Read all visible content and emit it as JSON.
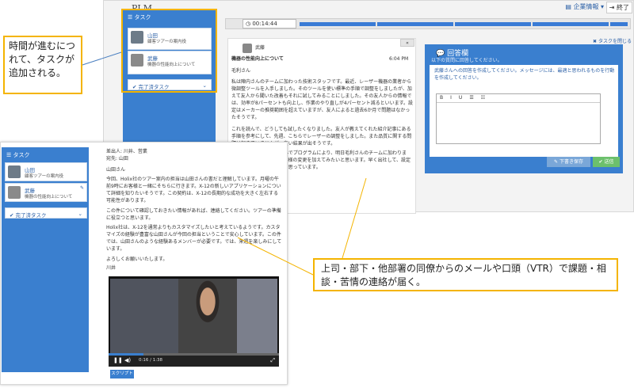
{
  "back": {
    "app_title": "PLM",
    "company_menu": "企業情報",
    "exit_label": "終了",
    "timer": "00:14:44",
    "close_task": "タスクを閉じる",
    "collapse": "«",
    "sidebar": {
      "header": "タスク",
      "tasks": [
        {
          "name": "山田",
          "subtitle": "顧客ツアーの案内役"
        },
        {
          "name": "武藤",
          "subtitle": "機器の性能向上について"
        }
      ],
      "done": "完了済タスク"
    },
    "mail": {
      "sender": "武藤",
      "subject": "機器の性能向上について",
      "time": "6:04 PM",
      "greeting": "毛利さん",
      "para1": "私は陣内さんのチームに加わった技術スタッフです。最近、レーザー機器の業者から微調整ツールを入手しました。そのツールを使い標準の手順で調整をしましたが、加えて友人から聞いた改善もそれに試してみることにしました。その友人からの情報では、効率が8パーセントも向上し、作業のやり直しが4パーセント減るといいます。設定はメーカーの推奨範囲を超えていますが、友人によると過去6か月で問題はなかったそうです。",
      "para2": "これを読んで、どうしても試したくなりました。友人が教えてくれた紹介記事にある手順を参考にして、先週、こちらでレーザーの調整をしました。また品質に関する問題は起きていませんが、良い結果が出そうです。",
      "para3": "明日は次のステップに進んでプログラムにより、明日毛利さんのチームに加わります。今後、他の機器にも同様の変更を加えてみたいと思います。早く出社して、設定の変更を済ませておこうと思っています。"
    },
    "answer": {
      "title": "回答欄",
      "subtitle": "以下の質問に回答してください。",
      "prompt": "武藤さんへの回答を作成してください。メッセージには、最適と思われるものを行動を作成してください。",
      "toolbar": [
        "B",
        "I",
        "U",
        "☰",
        "☷"
      ],
      "save": "下書き保存",
      "send": "送信"
    }
  },
  "front": {
    "sidebar": {
      "header": "タスク",
      "tasks": [
        {
          "name": "山田",
          "subtitle": "顧客ツアーの案内役"
        },
        {
          "name": "武藤",
          "subtitle": "機器の性能向上について"
        }
      ],
      "done": "完了済タスク"
    },
    "mail": {
      "from": "差出人: 川井、営業",
      "to": "宛先: 山田",
      "greeting": "山田さん",
      "para1": "今回、Holix社のツアー案内の担当は山田さんの書だと理解しています。月曜の午前9時にお客様と一緒にそちらに行きます。X-12の新しいアプリケーションについて詳細を知りたいそうです。この契約は、X-12の長期的な成功を大きく左右する可能性があります。",
      "para2": "この件について確認しておきたい情報があれば、連絡してください。ツアーの準備に役立つと思います。",
      "para3": "Holix社は、X-12を通常よりもカスタマイズしたいと考えているようです。カスタマイズの経験が豊富な山田さんが今回の担当ということで安心しています。この件では、山田さんのような経験あるメンバーが必要です。では、来週を楽しみにしています。",
      "closing": "よろしくお願いいたします。",
      "signature": "川井",
      "video_time": "0:16 / 1:38",
      "script_button": "スクリプト"
    }
  },
  "callouts": {
    "time": "時間が進むにつれて、タスクが追加される。",
    "messages": "上司・部下・他部署の同僚からのメールや口頭（VTR）で課題・相談・苦情の連絡が届く。"
  },
  "colors": {
    "accent": "#3a7fcf",
    "highlight": "#f4b400"
  }
}
